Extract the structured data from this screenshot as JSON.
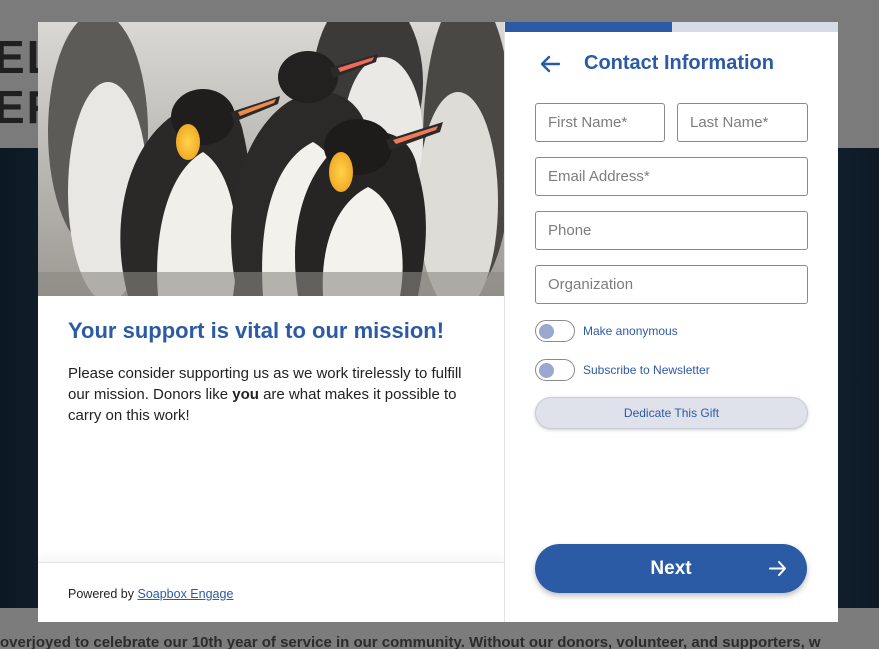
{
  "background": {
    "header_line1": "EL",
    "header_line2": "ER",
    "footer_text": "overjoyed to celebrate our 10th year of service in our community. Without our donors, volunteer, and supporters, w"
  },
  "modal": {
    "left": {
      "photo_icon": "penguins-photo",
      "title": "Your support is vital to our mission!",
      "body_before": "Please consider supporting us as we work tirelessly to fulfill our mission. Donors like ",
      "body_emphasis": "you",
      "body_after": " are what makes it possible to carry on this work!",
      "powered_prefix": "Powered by ",
      "powered_link": "Soapbox Engage"
    },
    "right": {
      "progress": 0.5,
      "back_icon": "arrow-left-icon",
      "title": "Contact Information",
      "fields": {
        "first_name": {
          "placeholder": "First Name*",
          "value": ""
        },
        "last_name": {
          "placeholder": "Last Name*",
          "value": ""
        },
        "email": {
          "placeholder": "Email Address*",
          "value": ""
        },
        "phone": {
          "placeholder": "Phone",
          "value": ""
        },
        "organization": {
          "placeholder": "Organization",
          "value": ""
        }
      },
      "toggles": {
        "anonymous": {
          "label": "Make anonymous",
          "checked": false
        },
        "newsletter": {
          "label": "Subscribe to Newsletter",
          "checked": false
        }
      },
      "dedicate_label": "Dedicate This Gift",
      "next_label": "Next",
      "next_icon": "arrow-right-icon"
    }
  },
  "colors": {
    "accent": "#2c5ba5",
    "progress_track": "#d6dbe8",
    "toggle_knob": "#9aa8cf"
  }
}
